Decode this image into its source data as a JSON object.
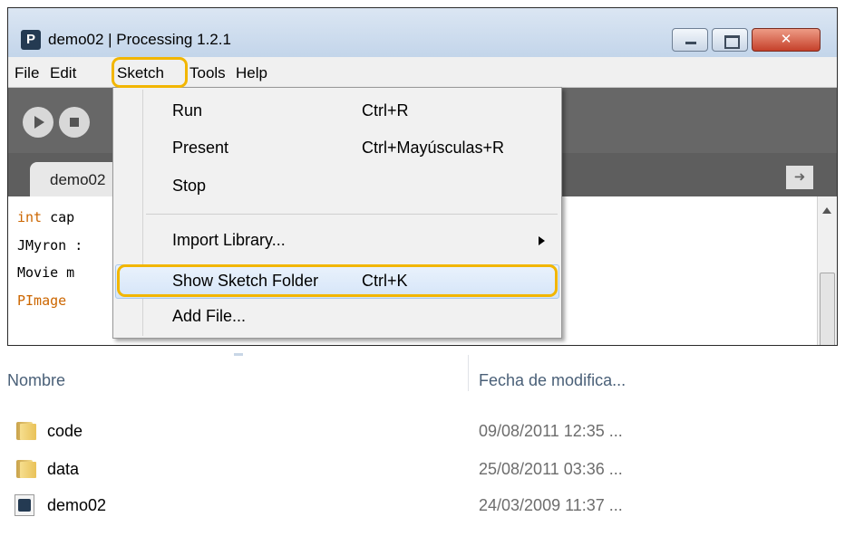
{
  "window": {
    "title": "demo02 | Processing 1.2.1",
    "controls": {
      "close_glyph": "✕"
    }
  },
  "menubar": {
    "items": [
      "File",
      "Edit",
      "Sketch",
      "Tools",
      "Help"
    ]
  },
  "tab": {
    "label": "demo02",
    "arrow": "➜"
  },
  "editor": {
    "lines": [
      {
        "kw": "int",
        "rest": " cap"
      },
      {
        "kw": "",
        "rest": "JMyron :"
      },
      {
        "kw": "",
        "rest": "Movie m"
      },
      {
        "kw": "PImage",
        "rest": ""
      }
    ]
  },
  "sketch_menu": {
    "items": [
      {
        "label": "Run",
        "shortcut": "Ctrl+R"
      },
      {
        "label": "Present",
        "shortcut": "Ctrl+Mayúsculas+R"
      },
      {
        "label": "Stop",
        "shortcut": ""
      },
      {
        "label": "Import Library...",
        "shortcut": ""
      },
      {
        "label": "Show Sketch Folder",
        "shortcut": "Ctrl+K"
      },
      {
        "label": "Add File...",
        "shortcut": ""
      }
    ],
    "highlight_color": "#f2b600"
  },
  "explorer": {
    "columns": {
      "name": "Nombre",
      "date": "Fecha de modifica..."
    },
    "files": [
      {
        "name": "code",
        "date": "09/08/2011 12:35 ...",
        "icon": "folder-icon"
      },
      {
        "name": "data",
        "date": "25/08/2011 03:36 ...",
        "icon": "folder-icon"
      },
      {
        "name": "demo02",
        "date": "24/03/2009 11:37 ...",
        "icon": "pde-file-icon"
      }
    ]
  }
}
